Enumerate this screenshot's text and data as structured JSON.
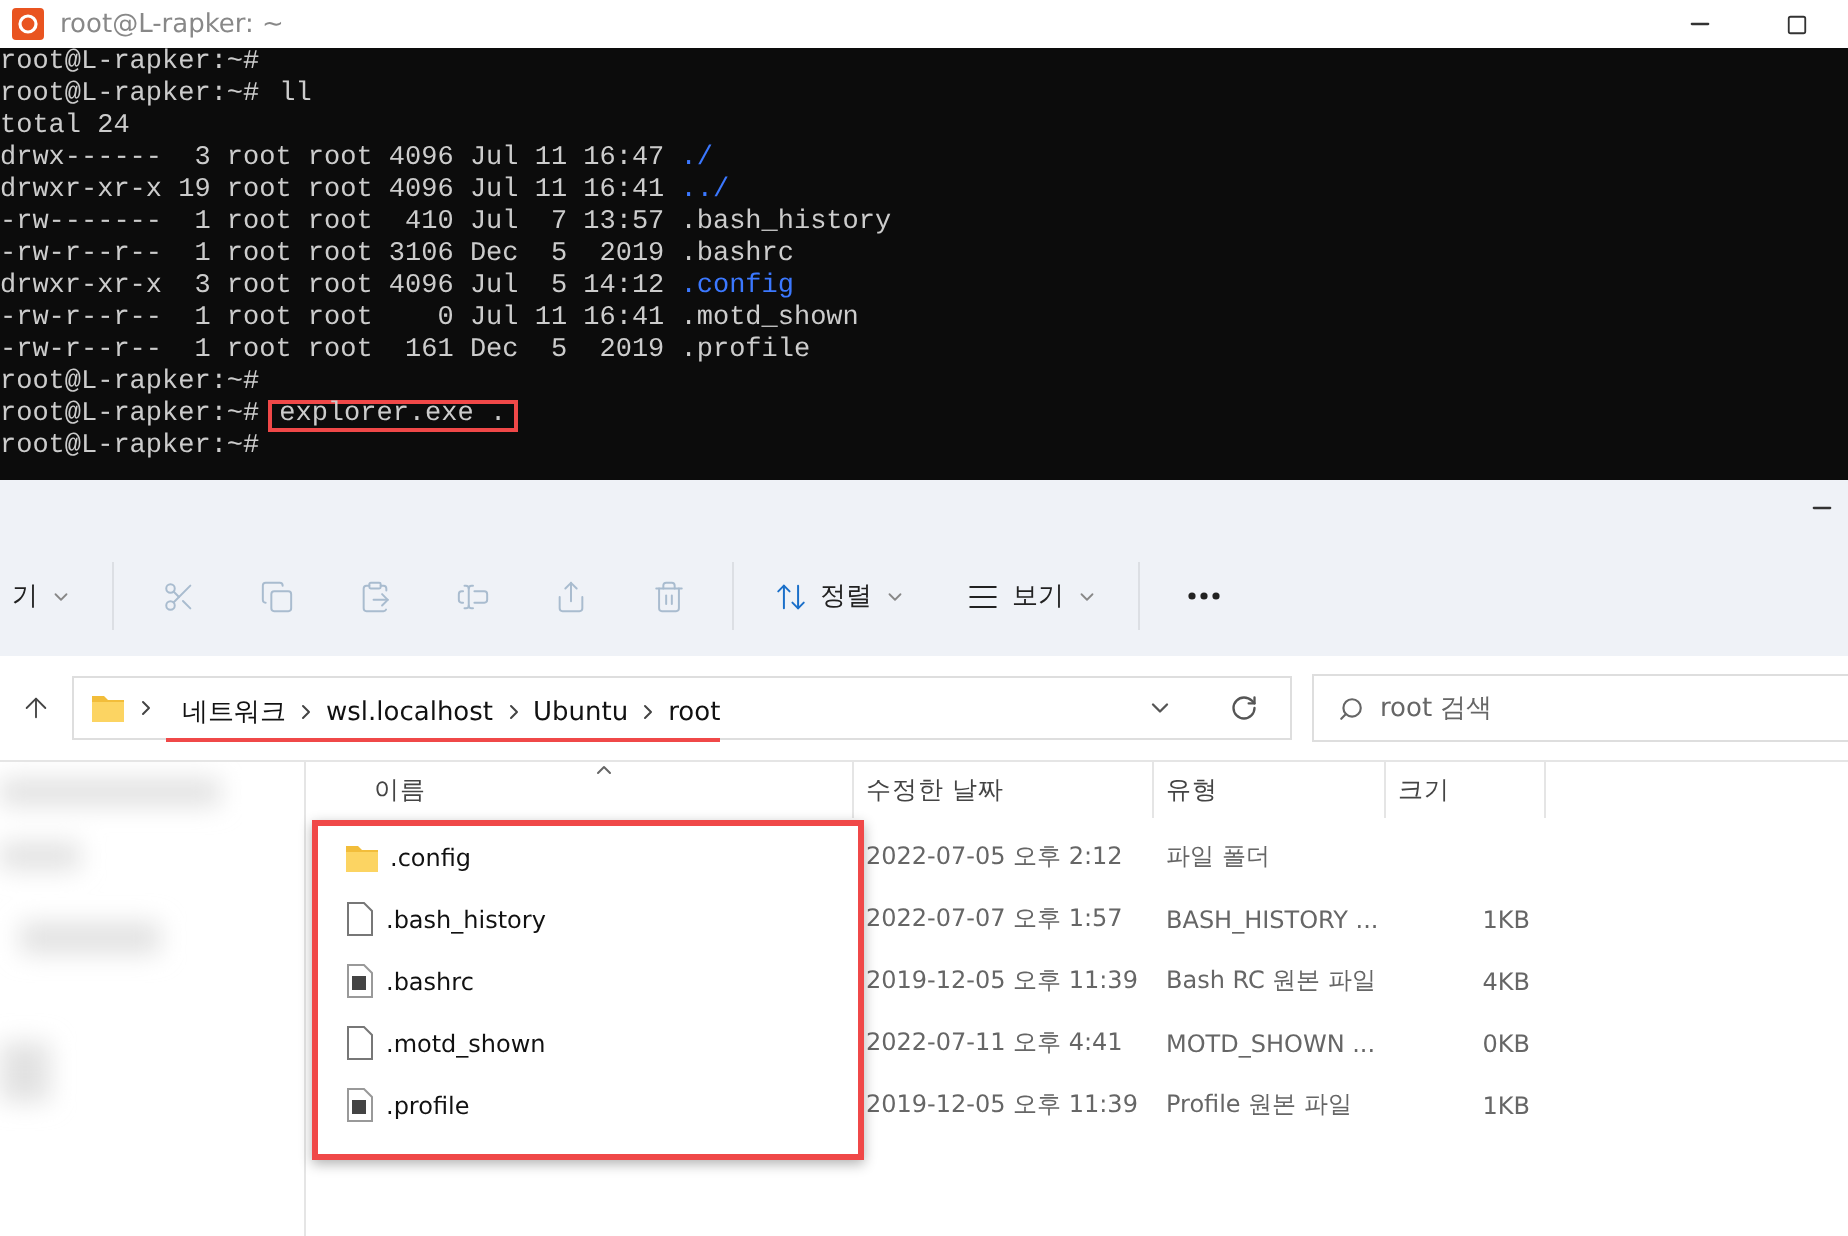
{
  "terminal": {
    "title": "root@L-rapker: ~",
    "lines": [
      {
        "kind": "prompt",
        "prompt": "root@L-rapker:~#"
      },
      {
        "kind": "prompt",
        "prompt": "root@L-rapker:~#",
        "command": "ll",
        "highlighted": false
      },
      {
        "kind": "output",
        "text": "total 24"
      },
      {
        "kind": "listing",
        "text": "drwx------  3 root root 4096 Jul 11 16:47 ",
        "name": "./",
        "dir": true
      },
      {
        "kind": "listing",
        "text": "drwxr-xr-x 19 root root 4096 Jul 11 16:41 ",
        "name": "../",
        "dir": true
      },
      {
        "kind": "listing",
        "text": "-rw-------  1 root root  410 Jul  7 13:57 ",
        "name": ".bash_history",
        "dir": false
      },
      {
        "kind": "listing",
        "text": "-rw-r--r--  1 root root 3106 Dec  5  2019 ",
        "name": ".bashrc",
        "dir": false
      },
      {
        "kind": "listing",
        "text": "drwxr-xr-x  3 root root 4096 Jul  5 14:12 ",
        "name": ".config",
        "dir": true
      },
      {
        "kind": "listing",
        "text": "-rw-r--r--  1 root root    0 Jul 11 16:41 ",
        "name": ".motd_shown",
        "dir": false
      },
      {
        "kind": "listing",
        "text": "-rw-r--r--  1 root root  161 Dec  5  2019 ",
        "name": ".profile",
        "dir": false
      },
      {
        "kind": "prompt",
        "prompt": "root@L-rapker:~#"
      },
      {
        "kind": "prompt",
        "prompt": "root@L-rapker:~#",
        "command": "explorer.exe .",
        "highlighted": true
      },
      {
        "kind": "prompt",
        "prompt": "root@L-rapker:~#"
      }
    ]
  },
  "explorer": {
    "toolbar": [
      {
        "items": [
          {
            "kind": "menu",
            "label": "기"
          }
        ]
      },
      {
        "items": [
          {
            "kind": "cut",
            "disabled": true
          },
          {
            "kind": "copy",
            "disabled": true
          },
          {
            "kind": "paste",
            "disabled": true
          },
          {
            "kind": "rename",
            "disabled": true
          },
          {
            "kind": "share",
            "disabled": true
          },
          {
            "kind": "delete",
            "disabled": true
          }
        ]
      },
      {
        "items": [
          {
            "kind": "sort",
            "label": "정렬"
          },
          {
            "kind": "view",
            "label": "보기"
          }
        ]
      },
      {
        "items": [
          {
            "kind": "more",
            "disabled": false
          }
        ]
      }
    ],
    "breadcrumbs": [
      "네트워크",
      "wsl.localhost",
      "Ubuntu",
      "root"
    ],
    "search": {
      "placeholder": "root 검색"
    },
    "columns": [
      "이름",
      "수정한 날짜",
      "유형",
      "크기"
    ],
    "rows": [
      {
        "kind": "folder",
        "name": ".config",
        "modified": "2022-07-05 오후 2:12",
        "type": "파일 폴더"
      },
      {
        "kind": "file",
        "name": ".bash_history",
        "modified": "2022-07-07 오후 1:57",
        "type": "BASH_HISTORY ...",
        "size": "1KB"
      },
      {
        "kind": "script",
        "name": ".bashrc",
        "modified": "2019-12-05 오후 11:39",
        "type": "Bash RC 원본 파일",
        "size": "4KB"
      },
      {
        "kind": "file",
        "name": ".motd_shown",
        "modified": "2022-07-11 오후 4:41",
        "type": "MOTD_SHOWN ...",
        "size": "0KB"
      },
      {
        "kind": "script",
        "name": ".profile",
        "modified": "2019-12-05 오후 11:39",
        "type": "Profile 원본 파일",
        "size": "1KB"
      }
    ]
  }
}
